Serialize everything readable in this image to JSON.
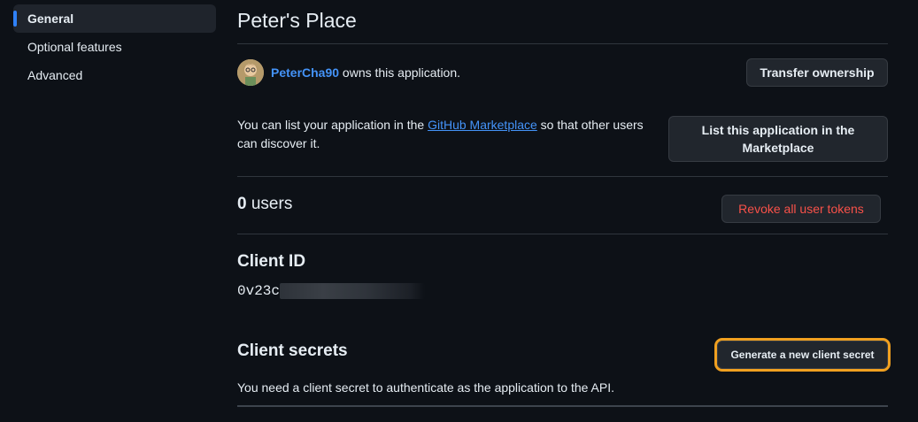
{
  "sidebar": {
    "items": [
      {
        "label": "General"
      },
      {
        "label": "Optional features"
      },
      {
        "label": "Advanced"
      }
    ]
  },
  "app": {
    "title": "Peter's Place"
  },
  "owner": {
    "username": "PeterCha90",
    "suffix": " owns this application.",
    "transfer_label": "Transfer ownership"
  },
  "marketplace": {
    "text_before": "You can list your application in the ",
    "link": "GitHub Marketplace",
    "text_after": " so that other users can discover it.",
    "button_label": "List this application in the Marketplace"
  },
  "users": {
    "count": "0",
    "label": " users",
    "revoke_label": "Revoke all user tokens"
  },
  "client_id": {
    "title": "Client ID",
    "value_visible": "0v23c"
  },
  "client_secrets": {
    "title": "Client secrets",
    "generate_label": "Generate a new client secret",
    "description": "You need a client secret to authenticate as the application to the API."
  },
  "colors": {
    "background": "#0d1117",
    "accent": "#2f81f7",
    "link": "#4493f8",
    "danger": "#f85149",
    "highlight": "#f0a020"
  }
}
